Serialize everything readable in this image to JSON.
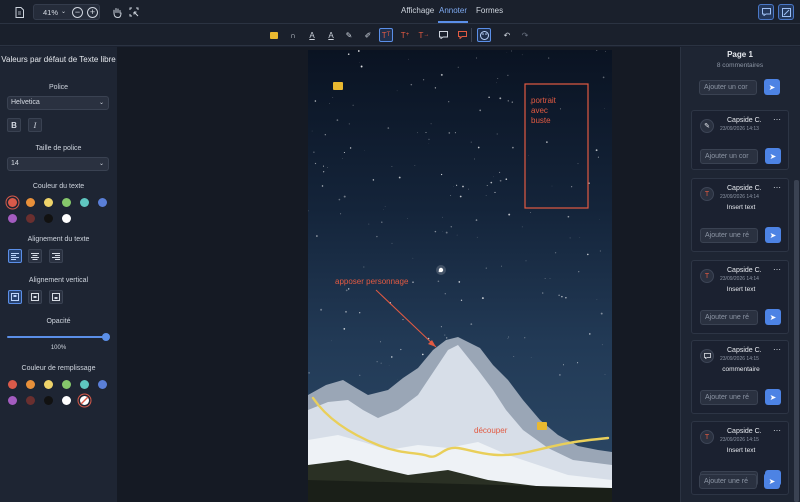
{
  "topbar": {
    "zoom": "41%",
    "tabs": [
      {
        "label": "Affichage"
      },
      {
        "label": "Annoter"
      },
      {
        "label": "Formes"
      }
    ]
  },
  "left": {
    "title": "Valeurs par défaut de Texte libre",
    "font_label": "Police",
    "font_value": "Helvetica",
    "bold": "B",
    "italic": "I",
    "size_label": "Taille de police",
    "size_value": "14",
    "text_color_label": "Couleur du texte",
    "text_colors": [
      "#d95a4a",
      "#e8903a",
      "#eed36a",
      "#86c86b",
      "#5fc6c0",
      "#5a7fd8",
      "#a45cc0",
      "#6a2f2f",
      "#111111",
      "#ffffff"
    ],
    "align_label": "Alignement du texte",
    "valign_label": "Alignement vertical",
    "opacity_label": "Opacité",
    "opacity_value": "100%",
    "opacity": 1.0,
    "fill_label": "Couleur de remplissage",
    "fill_colors": [
      "#d95a4a",
      "#e8903a",
      "#eed36a",
      "#86c86b",
      "#5fc6c0",
      "#5a7fd8",
      "#a45cc0",
      "#6a2f2f",
      "#111111",
      "#ffffff",
      "none"
    ]
  },
  "document": {
    "annotations": {
      "box_text": [
        "portrait",
        "avec",
        "buste"
      ],
      "arrow_text": "apposer personnage",
      "cut_text": "découper"
    }
  },
  "right": {
    "page_title": "Page 1",
    "comment_count": "8 commentaires",
    "reply_placeholder_top": "Ajouter un cor",
    "comments": [
      {
        "author": "Capside C.",
        "date": "23/09/2026 14:13",
        "body": "",
        "reply": "Ajouter un cor",
        "icon": "pen-icon"
      },
      {
        "author": "Capside C.",
        "date": "23/09/2026 14:14",
        "body": "Insert text",
        "reply": "Ajouter une ré",
        "icon": "insert-text-icon"
      },
      {
        "author": "Capside C.",
        "date": "23/09/2026 14:14",
        "body": "Insert text",
        "reply": "Ajouter une ré",
        "icon": "insert-text-icon"
      },
      {
        "author": "Capside C.",
        "date": "23/09/2026 14:15",
        "body": "commentaire",
        "reply": "Ajouter une ré",
        "icon": "comment-icon"
      },
      {
        "author": "Capside C.",
        "date": "23/09/2026 14:15",
        "body": "Insert text",
        "reply": "Ajouter une ré",
        "icon": "insert-text-icon"
      }
    ],
    "last_reply": "Ajouter une ré"
  },
  "colors": {
    "accent": "#4d83e4",
    "annotation_red": "#e25a42",
    "highlight_yellow": "#e9cf5a"
  }
}
